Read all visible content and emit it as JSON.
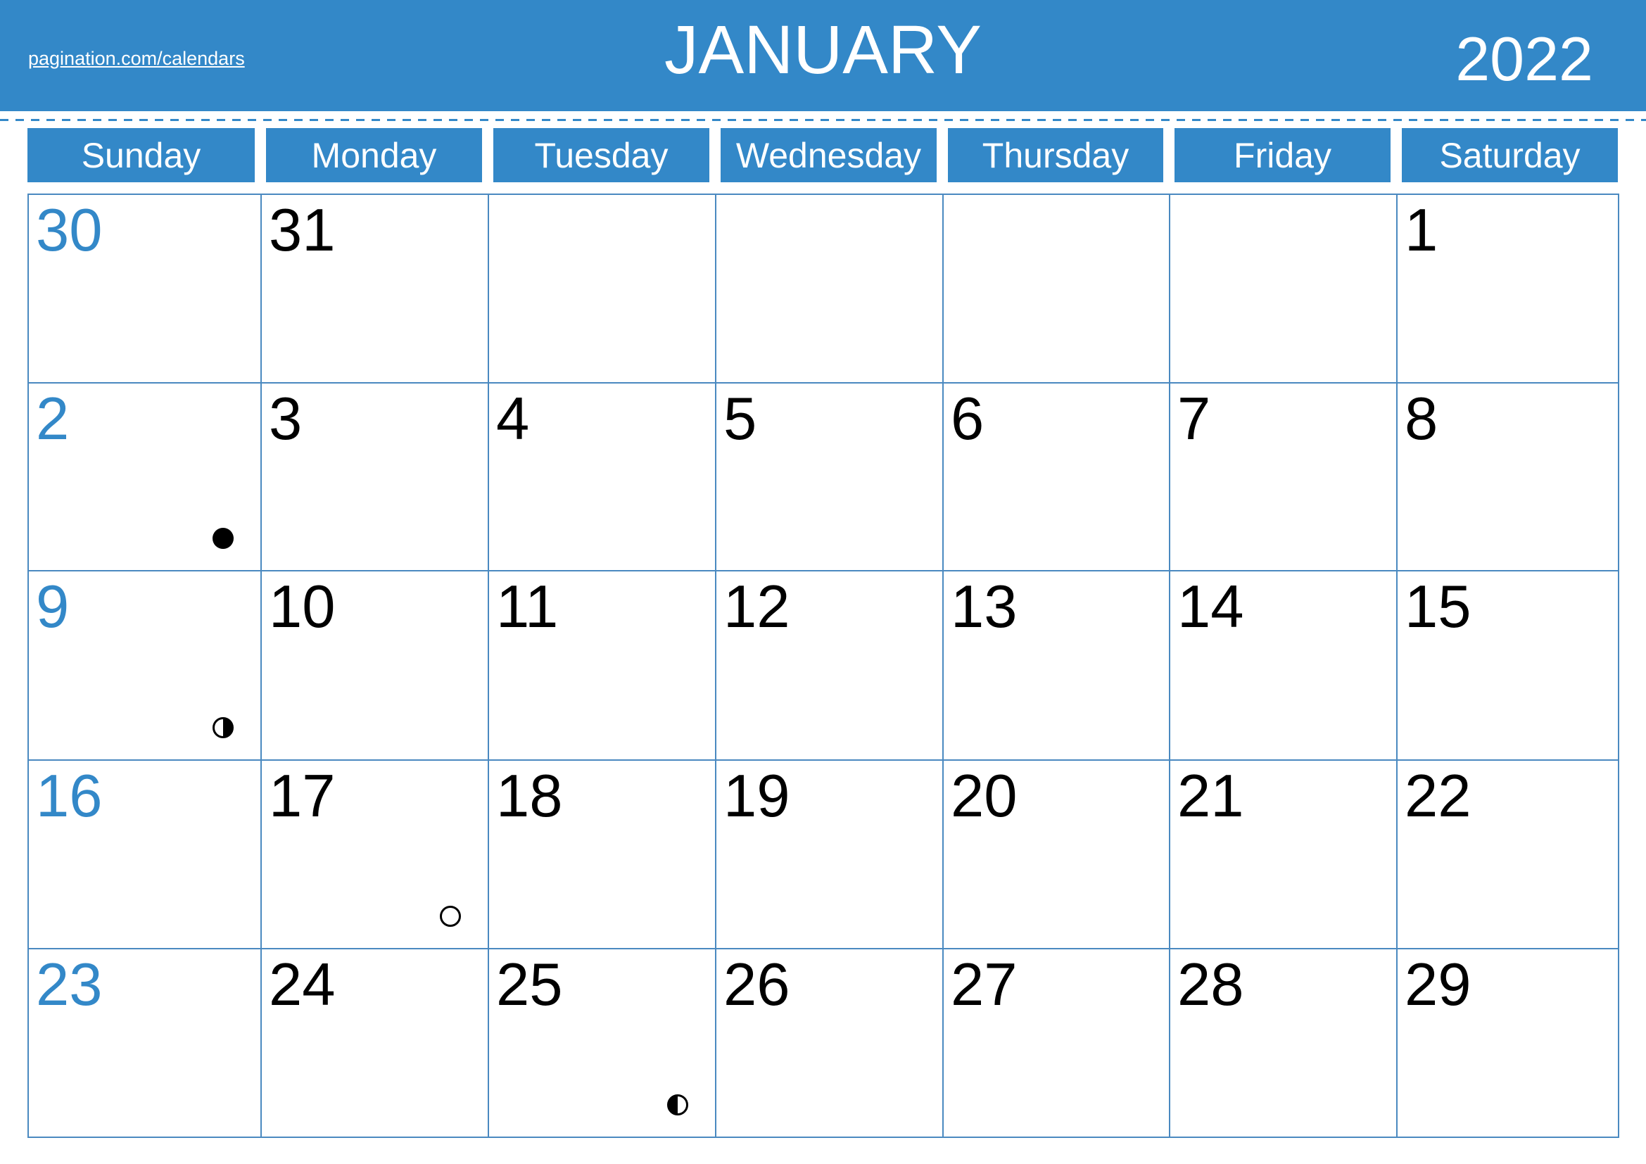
{
  "header": {
    "site_link": "pagination.com/calendars",
    "month": "JANUARY",
    "year": "2022",
    "accent_color": "#3388c8"
  },
  "weekdays": [
    "Sunday",
    "Monday",
    "Tuesday",
    "Wednesday",
    "Thursday",
    "Friday",
    "Saturday"
  ],
  "weeks": [
    [
      {
        "day": "30"
      },
      {
        "day": "31"
      },
      {
        "day": ""
      },
      {
        "day": ""
      },
      {
        "day": ""
      },
      {
        "day": ""
      },
      {
        "day": "1"
      }
    ],
    [
      {
        "day": "2",
        "moon": "new-moon"
      },
      {
        "day": "3"
      },
      {
        "day": "4"
      },
      {
        "day": "5"
      },
      {
        "day": "6"
      },
      {
        "day": "7"
      },
      {
        "day": "8"
      }
    ],
    [
      {
        "day": "9",
        "moon": "first-quarter"
      },
      {
        "day": "10"
      },
      {
        "day": "11"
      },
      {
        "day": "12"
      },
      {
        "day": "13"
      },
      {
        "day": "14"
      },
      {
        "day": "15"
      }
    ],
    [
      {
        "day": "16"
      },
      {
        "day": "17",
        "moon": "full-moon"
      },
      {
        "day": "18"
      },
      {
        "day": "19"
      },
      {
        "day": "20"
      },
      {
        "day": "21"
      },
      {
        "day": "22"
      }
    ],
    [
      {
        "day": "23"
      },
      {
        "day": "24"
      },
      {
        "day": "25",
        "moon": "last-quarter"
      },
      {
        "day": "26"
      },
      {
        "day": "27"
      },
      {
        "day": "28"
      },
      {
        "day": "29"
      }
    ]
  ]
}
